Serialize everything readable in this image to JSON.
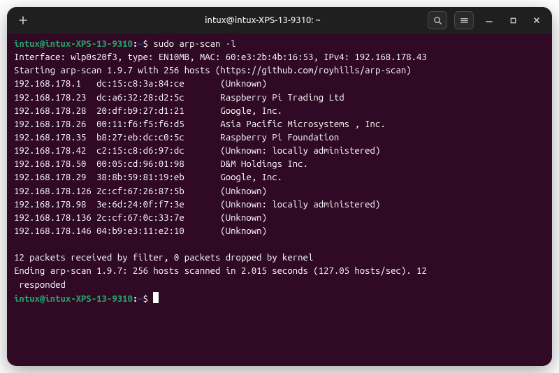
{
  "titlebar": {
    "title": "intux@intux-XPS-13-9310: ~"
  },
  "prompt": {
    "user_host": "intux@intux-XPS-13-9310",
    "colon": ":",
    "path": "~",
    "dollar": "$ "
  },
  "command": "sudo arp-scan -l",
  "interface_line": "Interface: wlp0s20f3, type: EN10MB, MAC: 60:e3:2b:4b:16:53, IPv4: 192.168.178.43",
  "starting_line": "Starting arp-scan 1.9.7 with 256 hosts (https://github.com/royhills/arp-scan)",
  "scan": [
    {
      "ip": "192.168.178.1",
      "mac": "dc:15:c8:3a:84:ce",
      "vendor": "(Unknown)"
    },
    {
      "ip": "192.168.178.23",
      "mac": "dc:a6:32:28:d2:5c",
      "vendor": "Raspberry Pi Trading Ltd"
    },
    {
      "ip": "192.168.178.28",
      "mac": "20:df:b9:27:d1:21",
      "vendor": "Google, Inc."
    },
    {
      "ip": "192.168.178.26",
      "mac": "00:11:f6:f5:f6:d5",
      "vendor": "Asia Pacific Microsystems , Inc."
    },
    {
      "ip": "192.168.178.35",
      "mac": "b8:27:eb:dc:c0:5c",
      "vendor": "Raspberry Pi Foundation"
    },
    {
      "ip": "192.168.178.42",
      "mac": "c2:15:c8:d6:97:dc",
      "vendor": "(Unknown: locally administered)"
    },
    {
      "ip": "192.168.178.50",
      "mac": "00:05:cd:96:01:98",
      "vendor": "D&M Holdings Inc."
    },
    {
      "ip": "192.168.178.29",
      "mac": "38:8b:59:81:19:eb",
      "vendor": "Google, Inc."
    },
    {
      "ip": "192.168.178.126",
      "mac": "2c:cf:67:26:87:5b",
      "vendor": "(Unknown)"
    },
    {
      "ip": "192.168.178.98",
      "mac": "3e:6d:24:0f:f7:3e",
      "vendor": "(Unknown: locally administered)"
    },
    {
      "ip": "192.168.178.136",
      "mac": "2c:cf:67:0c:33:7e",
      "vendor": "(Unknown)"
    },
    {
      "ip": "192.168.178.146",
      "mac": "04:b9:e3:11:e2:10",
      "vendor": "(Unknown)"
    }
  ],
  "summary_packets": "12 packets received by filter, 0 packets dropped by kernel",
  "summary_ending_1": "Ending arp-scan 1.9.7: 256 hosts scanned in 2.015 seconds (127.05 hosts/sec). 12",
  "summary_ending_2": " responded",
  "colors": {
    "bg": "#300a24",
    "prompt_green": "#26a269",
    "prompt_blue": "#12488b"
  }
}
